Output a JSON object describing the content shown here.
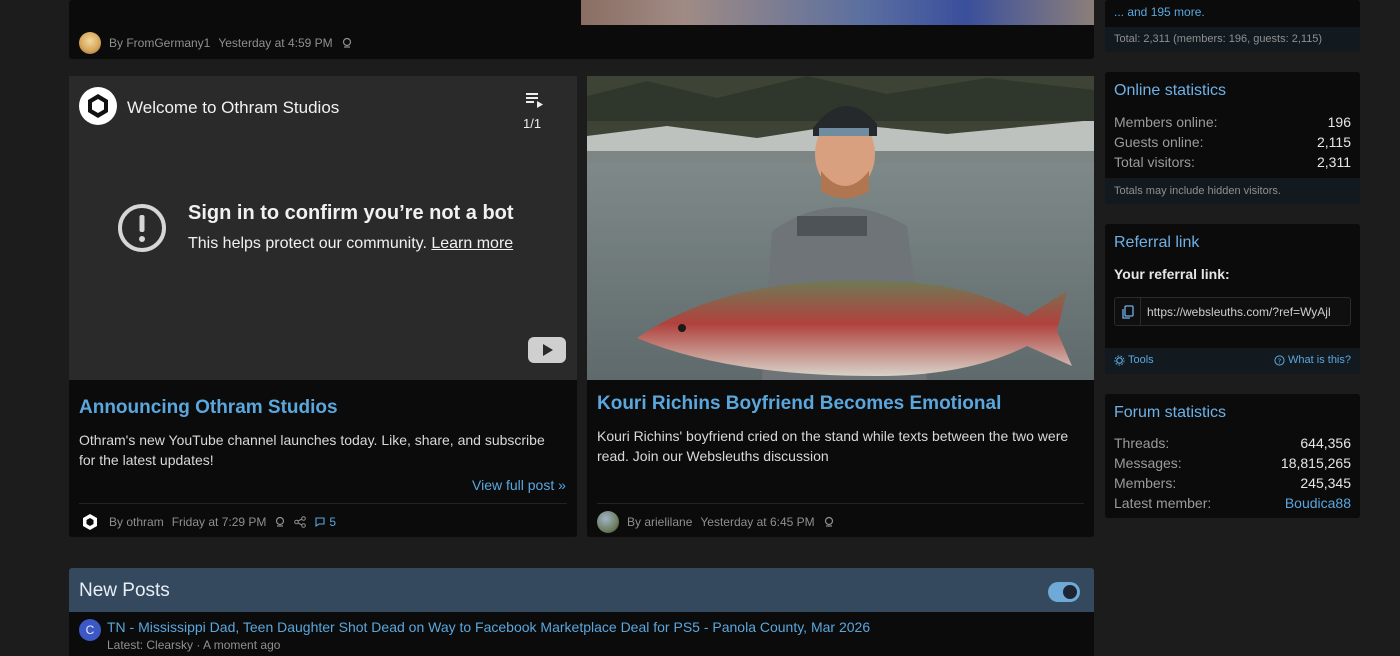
{
  "top_card_left": {
    "author_meta": "By FromGermany1",
    "time": "Yesterday at 4:59 PM"
  },
  "sidebar_online_top": {
    "more_link": "... and 195 more.",
    "total_line": "Total: 2,311 (members: 196, guests: 2,115)"
  },
  "post1": {
    "video": {
      "channel_title": "Welcome to Othram Studios",
      "playlist_count": "1/1",
      "warning_title": "Sign in to confirm you’re not a bot",
      "warning_text": "This helps protect our community.",
      "learn_more": "Learn more"
    },
    "title": "Announcing Othram Studios",
    "body": "Othram's new YouTube channel launches today. Like, share, and subscribe for the latest updates!",
    "view_full": "View full post »",
    "author": "By othram",
    "time": "Friday at 7:29 PM",
    "comments": "5"
  },
  "post2": {
    "title": "Kouri Richins Boyfriend Becomes Emotional",
    "body": "Kouri Richins' boyfriend cried on the stand while texts between the two were read. Join our Websleuths discussion",
    "author": "By arielilane",
    "time": "Yesterday at 6:45 PM"
  },
  "online_statistics": {
    "heading": "Online statistics",
    "rows": [
      {
        "label": "Members online:",
        "value": "196"
      },
      {
        "label": "Guests online:",
        "value": "2,115"
      },
      {
        "label": "Total visitors:",
        "value": "2,311"
      }
    ],
    "footer": "Totals may include hidden visitors."
  },
  "referral": {
    "heading": "Referral link",
    "label": "Your referral link:",
    "url": "https://websleuths.com/?ref=WyAjl",
    "tools": "Tools",
    "what_is": "What is this?"
  },
  "forum_statistics": {
    "heading": "Forum statistics",
    "rows": [
      {
        "label": "Threads:",
        "value": "644,356"
      },
      {
        "label": "Messages:",
        "value": "18,815,265"
      },
      {
        "label": "Members:",
        "value": "245,345"
      },
      {
        "label": "Latest member:",
        "value": "Boudica88"
      }
    ]
  },
  "new_posts": {
    "heading": "New Posts",
    "items": [
      {
        "avatar_letter": "C",
        "title": "TN - Mississippi Dad, Teen Daughter Shot Dead on Way to Facebook Marketplace Deal for PS5 - Panola County, Mar 2026",
        "latest": "Latest: Clearsky · A moment ago"
      }
    ]
  },
  "colors": {
    "accent": "#5aa7de",
    "page_bg": "#1c1c1c",
    "card_bg": "#0b0b0b",
    "new_posts_header": "#34495e"
  }
}
